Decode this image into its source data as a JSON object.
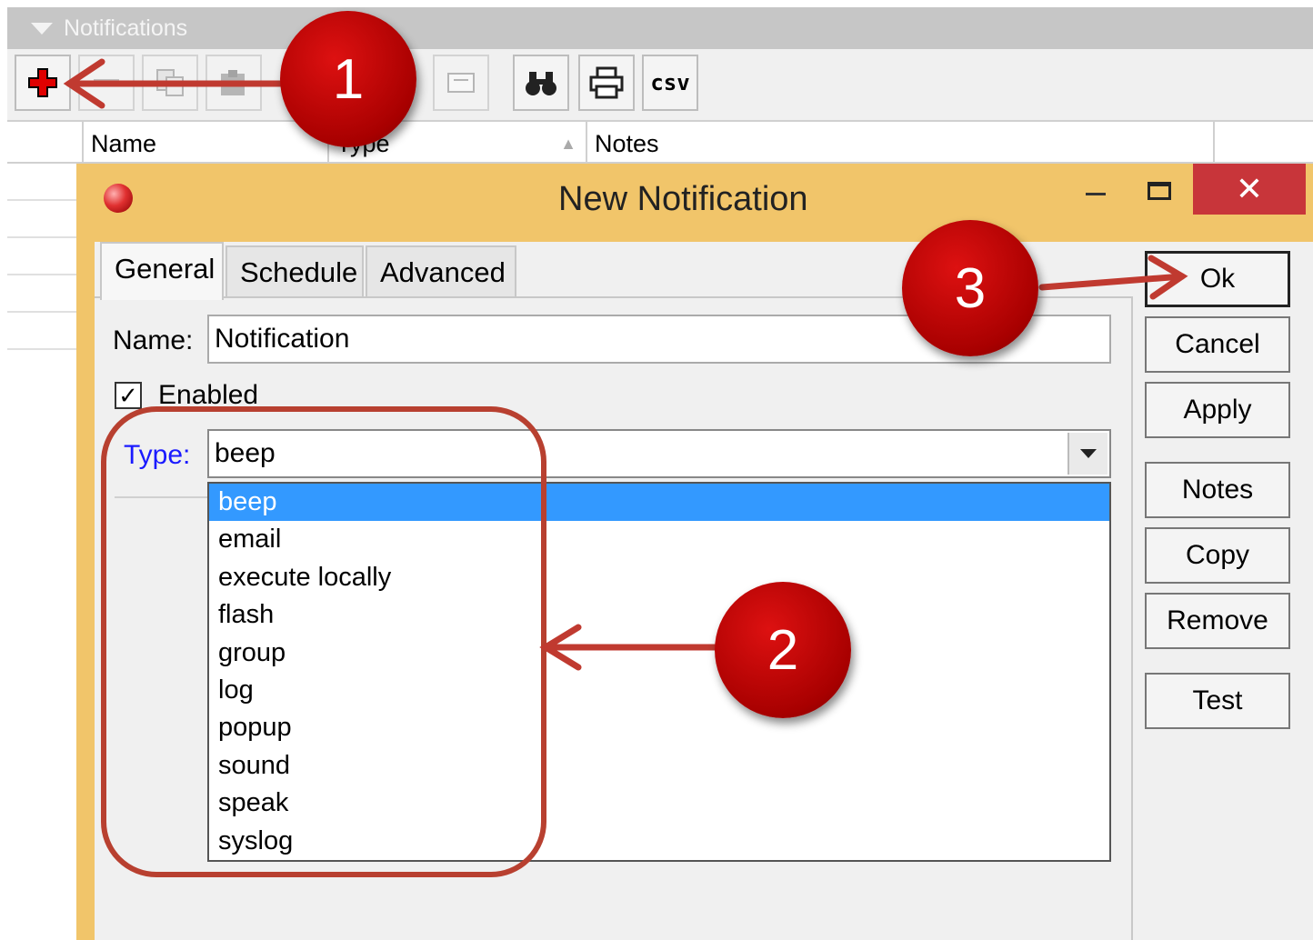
{
  "panel": {
    "title": "Notifications",
    "toolbar": [
      {
        "name": "add-icon"
      },
      {
        "name": "remove-icon"
      },
      {
        "name": "copy-icon"
      },
      {
        "name": "paste-icon"
      },
      {
        "name": "comment-icon"
      },
      {
        "name": "find-icon"
      },
      {
        "name": "print-icon"
      },
      {
        "name": "csv-icon",
        "label": "csv"
      }
    ],
    "columns": [
      "Name",
      "Type",
      "Notes"
    ]
  },
  "dialog": {
    "title": "New Notification",
    "tabs": [
      "General",
      "Schedule",
      "Advanced"
    ],
    "active_tab": "General",
    "name_label": "Name:",
    "name_value": "Notification",
    "enabled_label": "Enabled",
    "enabled_checked": true,
    "type_label": "Type:",
    "type_value": "beep",
    "type_options": [
      "beep",
      "email",
      "execute locally",
      "flash",
      "group",
      "log",
      "popup",
      "sound",
      "speak",
      "syslog"
    ],
    "buttons": [
      "Ok",
      "Cancel",
      "Apply",
      "Notes",
      "Copy",
      "Remove",
      "Test"
    ]
  },
  "annotations": {
    "callouts": [
      "1",
      "2",
      "3"
    ],
    "color": "#b00000"
  }
}
